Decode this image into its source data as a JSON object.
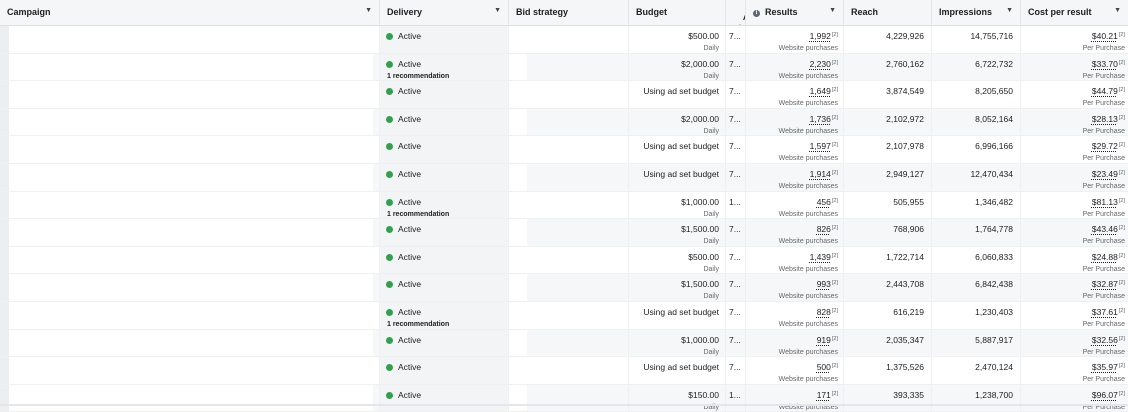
{
  "columns": {
    "campaign": "Campaign",
    "delivery": "Delivery",
    "bid_strategy": "Bid strategy",
    "budget": "Budget",
    "attribution": "Att\nset",
    "results": "Results",
    "reach": "Reach",
    "impressions": "Impressions",
    "cost_per_result": "Cost per result"
  },
  "labels": {
    "daily": "Daily",
    "using_ad_set_budget": "Using ad set budget",
    "website_purchases": "Website purchases",
    "per_purchase": "Per Purchase",
    "recommendation": "1 recommendation",
    "ref_mark": "[2]"
  },
  "rows": [
    {
      "delivery": "Active",
      "rec": "",
      "budget": "$500.00",
      "daily": "Daily",
      "att": "7...",
      "results": "1,992",
      "results_sub": "Website purchases",
      "reach": "4,229,926",
      "impressions": "14,755,716",
      "cost": "$40.21",
      "cost_sub": "Per Purchase"
    },
    {
      "delivery": "Active",
      "rec": "1 recommendation",
      "budget": "$2,000.00",
      "daily": "Daily",
      "att": "7...",
      "results": "2,230",
      "results_sub": "Website purchases",
      "reach": "2,760,162",
      "impressions": "6,722,732",
      "cost": "$33.70",
      "cost_sub": "Per Purchase"
    },
    {
      "delivery": "Active",
      "rec": "",
      "budget": "Using ad set budget",
      "daily": "",
      "att": "7...",
      "results": "1,649",
      "results_sub": "Website purchases",
      "reach": "3,874,549",
      "impressions": "8,205,650",
      "cost": "$44.79",
      "cost_sub": "Per Purchase"
    },
    {
      "delivery": "Active",
      "rec": "",
      "budget": "$2,000.00",
      "daily": "Daily",
      "att": "7...",
      "results": "1,736",
      "results_sub": "Website purchases",
      "reach": "2,102,972",
      "impressions": "8,052,164",
      "cost": "$28.13",
      "cost_sub": "Per Purchase"
    },
    {
      "delivery": "Active",
      "rec": "",
      "budget": "Using ad set budget",
      "daily": "",
      "att": "7...",
      "results": "1,597",
      "results_sub": "Website purchases",
      "reach": "2,107,978",
      "impressions": "6,996,166",
      "cost": "$29.72",
      "cost_sub": "Per Purchase"
    },
    {
      "delivery": "Active",
      "rec": "",
      "budget": "Using ad set budget",
      "daily": "",
      "att": "7...",
      "results": "1,914",
      "results_sub": "Website purchases",
      "reach": "2,949,127",
      "impressions": "12,470,434",
      "cost": "$23.49",
      "cost_sub": "Per Purchase"
    },
    {
      "delivery": "Active",
      "rec": "1 recommendation",
      "budget": "$1,000.00",
      "daily": "Daily",
      "att": "1...",
      "results": "456",
      "results_sub": "Website purchases",
      "reach": "505,955",
      "impressions": "1,346,482",
      "cost": "$81.13",
      "cost_sub": "Per Purchase"
    },
    {
      "delivery": "Active",
      "rec": "",
      "budget": "$1,500.00",
      "daily": "Daily",
      "att": "7...",
      "results": "826",
      "results_sub": "Website purchases",
      "reach": "768,906",
      "impressions": "1,764,778",
      "cost": "$43.46",
      "cost_sub": "Per Purchase"
    },
    {
      "delivery": "Active",
      "rec": "",
      "budget": "$500.00",
      "daily": "Daily",
      "att": "7...",
      "results": "1,439",
      "results_sub": "Website purchases",
      "reach": "1,722,714",
      "impressions": "6,060,833",
      "cost": "$24.88",
      "cost_sub": "Per Purchase"
    },
    {
      "delivery": "Active",
      "rec": "",
      "budget": "$1,500.00",
      "daily": "Daily",
      "att": "7...",
      "results": "993",
      "results_sub": "Website purchases",
      "reach": "2,443,708",
      "impressions": "6,842,438",
      "cost": "$32.87",
      "cost_sub": "Per Purchase"
    },
    {
      "delivery": "Active",
      "rec": "1 recommendation",
      "budget": "Using ad set budget",
      "daily": "",
      "att": "7...",
      "results": "828",
      "results_sub": "Website purchases",
      "reach": "616,219",
      "impressions": "1,230,403",
      "cost": "$37.61",
      "cost_sub": "Per Purchase"
    },
    {
      "delivery": "Active",
      "rec": "",
      "budget": "$1,000.00",
      "daily": "Daily",
      "att": "7...",
      "results": "919",
      "results_sub": "Website purchases",
      "reach": "2,035,347",
      "impressions": "5,887,917",
      "cost": "$32.56",
      "cost_sub": "Per Purchase"
    },
    {
      "delivery": "Active",
      "rec": "",
      "budget": "Using ad set budget",
      "daily": "",
      "att": "7...",
      "results": "500",
      "results_sub": "Website purchases",
      "reach": "1,375,526",
      "impressions": "2,470,124",
      "cost": "$35.97",
      "cost_sub": "Per Purchase"
    },
    {
      "delivery": "Active",
      "rec": "",
      "budget": "$150.00",
      "daily": "Daily",
      "att": "1...",
      "results": "171",
      "results_sub": "Website purchases",
      "reach": "393,335",
      "impressions": "1,238,700",
      "cost": "$96.07",
      "cost_sub": "Per Purchase"
    }
  ],
  "colors": {
    "active_dot": "#31a24c",
    "header_bg": "#f5f6f7"
  }
}
